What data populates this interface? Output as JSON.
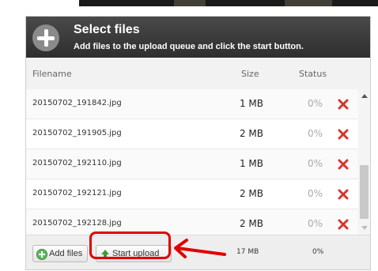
{
  "header": {
    "title": "Select files",
    "subtitle": "Add files to the upload queue and click the start button.",
    "icon": "plus-circle-icon"
  },
  "columns": {
    "filename": "Filename",
    "size": "Size",
    "status": "Status"
  },
  "files": [
    {
      "name": "20150702_191842.jpg",
      "size": "1 MB",
      "status": "0%"
    },
    {
      "name": "20150702_191905.jpg",
      "size": "2 MB",
      "status": "0%"
    },
    {
      "name": "20150702_192110.jpg",
      "size": "1 MB",
      "status": "0%"
    },
    {
      "name": "20150702_192121.jpg",
      "size": "2 MB",
      "status": "0%"
    },
    {
      "name": "20150702_192128.jpg",
      "size": "2 MB",
      "status": "0%"
    }
  ],
  "footer": {
    "add_label": "Add files",
    "start_label": "Start upload",
    "total_size": "17 MB",
    "total_status": "0%"
  },
  "colors": {
    "header_bg": "#3a3a3a",
    "remove_icon": "#d9342b",
    "annotation": "#e00000"
  }
}
